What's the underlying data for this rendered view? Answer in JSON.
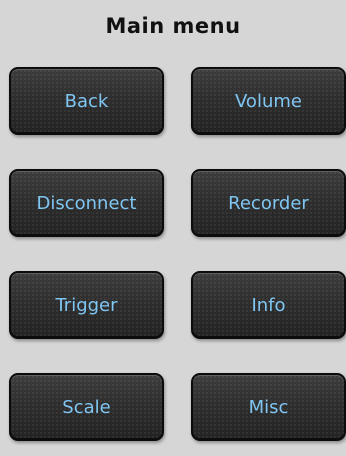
{
  "title": "Main menu",
  "buttons": [
    {
      "label": "Back"
    },
    {
      "label": "Volume"
    },
    {
      "label": "Disconnect"
    },
    {
      "label": "Recorder"
    },
    {
      "label": "Trigger"
    },
    {
      "label": "Info"
    },
    {
      "label": "Scale"
    },
    {
      "label": "Misc"
    }
  ],
  "colors": {
    "background": "#d6d6d6",
    "button_face": "#2e2e2e",
    "button_text": "#7fc6f3",
    "title_text": "#111111"
  }
}
